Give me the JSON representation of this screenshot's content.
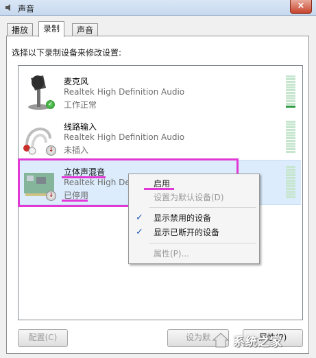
{
  "window": {
    "title": "声音",
    "close_label": "×"
  },
  "tabs": [
    {
      "label": "播放",
      "active": false
    },
    {
      "label": "录制",
      "active": true
    },
    {
      "label": "声音",
      "active": false
    }
  ],
  "instruction": "选择以下录制设备来修改设置:",
  "devices": [
    {
      "name": "麦克风",
      "description": "Realtek High Definition Audio",
      "status": "工作正常",
      "icon": "microphone-icon",
      "badge": "check",
      "meter_level": 0.1
    },
    {
      "name": "线路输入",
      "description": "Realtek High Definition Audio",
      "status": "未插入",
      "icon": "line-in-cable-icon",
      "badge": "down-arrow",
      "meter_level": 0
    },
    {
      "name": "立体声混音",
      "description": "Realtek High Definition Audio",
      "status": "已停用",
      "icon": "sound-card-icon",
      "badge": "down-arrow",
      "meter_level": 0
    }
  ],
  "context_menu": {
    "items": [
      {
        "label": "启用",
        "disabled": false,
        "checked": false
      },
      {
        "label": "设置为默认设备(D)",
        "disabled": true,
        "checked": false
      },
      {
        "label": "显示禁用的设备",
        "disabled": false,
        "checked": true
      },
      {
        "label": "显示已断开的设备",
        "disabled": false,
        "checked": true
      },
      {
        "label": "属性(P)...",
        "disabled": true,
        "checked": false
      }
    ]
  },
  "buttons": {
    "configure": "配置(C)",
    "set_default": "设为默",
    "properties": "属性(P)"
  },
  "watermark": {
    "text": "系统之家"
  },
  "colors": {
    "highlight": "#e238d6",
    "selection": "#dcecfc",
    "meter_on": "#2b9c44",
    "meter_off": "#c6e6cf"
  }
}
